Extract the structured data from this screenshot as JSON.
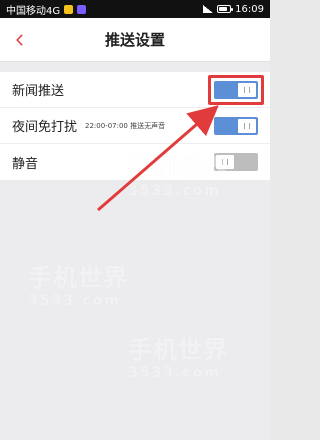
{
  "status_bar": {
    "carrier": "中国移动4G",
    "time": "16:09"
  },
  "header": {
    "title": "推送设置",
    "back_icon": "back-arrow-icon"
  },
  "settings": [
    {
      "label": "新闻推送",
      "sub": "",
      "state": "on"
    },
    {
      "label": "夜间免打扰",
      "sub": "22:00-07:00 推送无声音",
      "state": "on"
    },
    {
      "label": "静音",
      "sub": "",
      "state": "off"
    }
  ],
  "watermark": {
    "text_main": "手机世界",
    "text_sub": "3533.com"
  },
  "colors": {
    "accent_red": "#e13b3b",
    "toggle_on": "#5c8fd6",
    "toggle_off": "#bdbdbd"
  }
}
